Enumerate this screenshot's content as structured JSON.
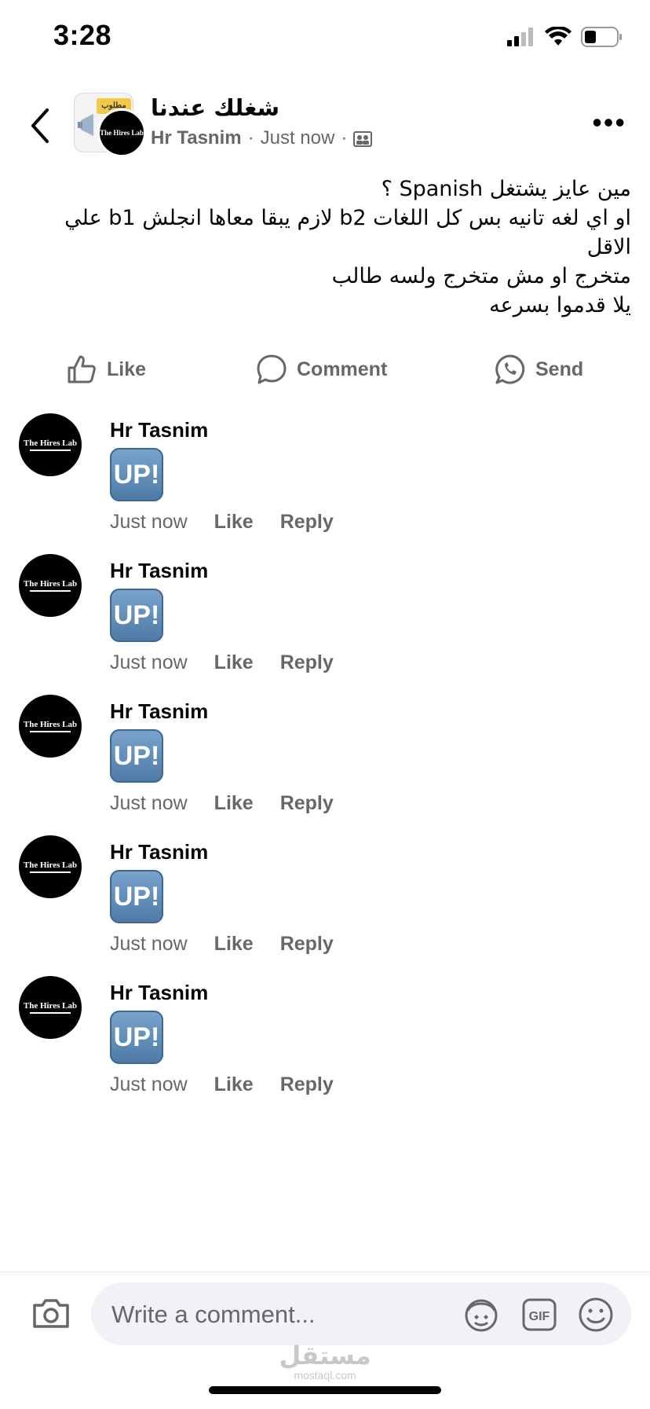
{
  "status_bar": {
    "time": "3:28"
  },
  "header": {
    "group_name": "شغلك عندنا",
    "author": "Hr Tasnim",
    "time": "Just now",
    "separator": "·",
    "group_sticker_text": "مطلوب",
    "page_avatar_text": "The Hires Lab"
  },
  "post": {
    "lines": [
      "مين عايز يشتغل Spanish ؟",
      "او اي لغه تانيه بس كل اللغات b2 لازم يبقا معاها انجلش b1 علي الاقل",
      "متخرج او مش متخرج ولسه طالب",
      "يلا قدموا بسرعه"
    ]
  },
  "actions": {
    "like": "Like",
    "comment": "Comment",
    "send": "Send"
  },
  "comments": [
    {
      "author": "Hr Tasnim",
      "sticker": "UP!",
      "time": "Just now",
      "like": "Like",
      "reply": "Reply",
      "avatar_text": "The Hires Lab"
    },
    {
      "author": "Hr Tasnim",
      "sticker": "UP!",
      "time": "Just now",
      "like": "Like",
      "reply": "Reply",
      "avatar_text": "The Hires Lab"
    },
    {
      "author": "Hr Tasnim",
      "sticker": "UP!",
      "time": "Just now",
      "like": "Like",
      "reply": "Reply",
      "avatar_text": "The Hires Lab"
    },
    {
      "author": "Hr Tasnim",
      "sticker": "UP!",
      "time": "Just now",
      "like": "Like",
      "reply": "Reply",
      "avatar_text": "The Hires Lab"
    },
    {
      "author": "Hr Tasnim",
      "sticker": "UP!",
      "time": "Just now",
      "like": "Like",
      "reply": "Reply",
      "avatar_text": "The Hires Lab"
    }
  ],
  "composer": {
    "placeholder": "Write a comment...",
    "gif_label": "GIF"
  },
  "watermark": {
    "arabic": "مستقل",
    "latin": "mostaql.com"
  },
  "colors": {
    "secondary_text": "#65676b",
    "input_bg": "#f0f2f5",
    "sticker_blue": "#5a87b3"
  }
}
